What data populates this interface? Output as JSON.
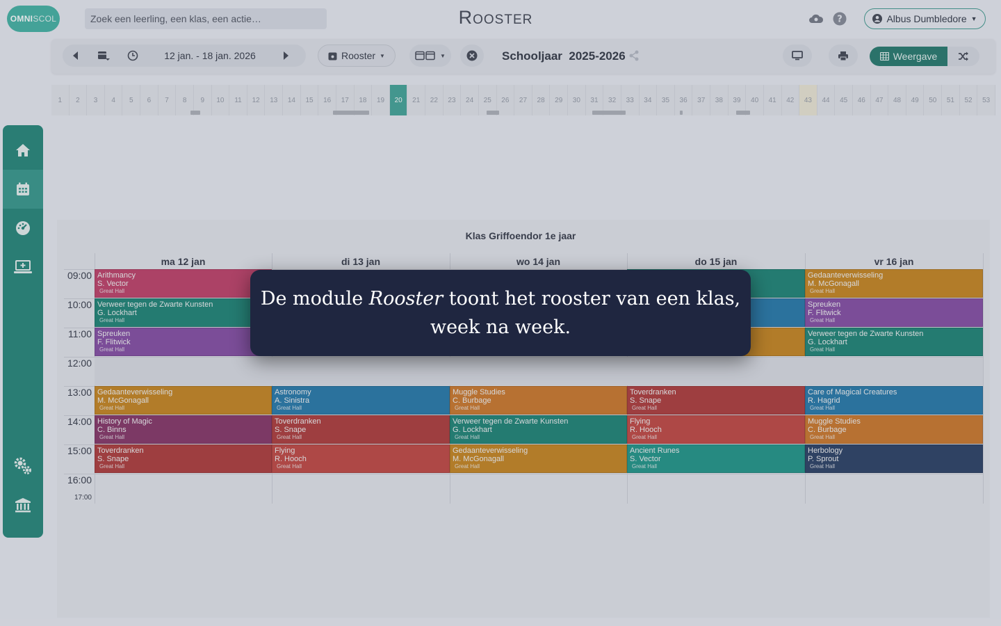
{
  "header": {
    "logo_text_bold": "OMNI",
    "logo_text_light": "SCOL",
    "search_placeholder": "Zoek een leerling, een klas, een actie…",
    "page_title": "Rooster",
    "user_name": "Albus Dumbledore"
  },
  "toolbar": {
    "date_range": "12 jan. - 18 jan. 2026",
    "rooster_dropdown": "Rooster",
    "year_prefix": "Schooljaar",
    "year_value": "2025-2026",
    "weergave_label": "Weergave"
  },
  "weekstrip": {
    "weeks": [
      "1",
      "2",
      "3",
      "4",
      "5",
      "6",
      "7",
      "8",
      "9",
      "10",
      "11",
      "12",
      "13",
      "14",
      "15",
      "16",
      "17",
      "18",
      "19",
      "20",
      "21",
      "22",
      "23",
      "24",
      "25",
      "26",
      "27",
      "28",
      "29",
      "30",
      "31",
      "32",
      "33",
      "34",
      "35",
      "36",
      "37",
      "38",
      "39",
      "40",
      "41",
      "42",
      "43",
      "44",
      "45",
      "46",
      "47",
      "48",
      "49",
      "50",
      "51",
      "52",
      "53"
    ],
    "active_week": "20",
    "highlighted_week": "43"
  },
  "calendar": {
    "title": "Klas Griffoendor 1e jaar",
    "days": [
      "ma 12 jan",
      "di 13 jan",
      "wo 14 jan",
      "do 15 jan",
      "vr 16 jan"
    ],
    "times": [
      "09:00",
      "10:00",
      "11:00",
      "12:00",
      "13:00",
      "14:00",
      "15:00",
      "16:00"
    ],
    "end_time": "17:00",
    "lessons": [
      {
        "day": 0,
        "slot": 0,
        "subject": "Arithmancy",
        "teacher": "S. Vector",
        "room": "Great Hall",
        "color": "#c2486f"
      },
      {
        "day": 0,
        "slot": 1,
        "subject": "Verweer tegen de Zwarte Kunsten",
        "teacher": "G. Lockhart",
        "room": "Great Hall",
        "color": "#27897c"
      },
      {
        "day": 0,
        "slot": 2,
        "subject": "Spreuken",
        "teacher": "F. Flitwick",
        "room": "Great Hall",
        "color": "#8a55a8"
      },
      {
        "day": 0,
        "slot": 4,
        "subject": "Gedaanteverwisseling",
        "teacher": "M. McGonagall",
        "room": "Great Hall",
        "color": "#c98a2a"
      },
      {
        "day": 0,
        "slot": 5,
        "subject": "History of Magic",
        "teacher": "C. Binns",
        "room": "Great Hall",
        "color": "#8b3e6e"
      },
      {
        "day": 0,
        "slot": 6,
        "subject": "Toverdranken",
        "teacher": "S. Snape",
        "room": "Great Hall",
        "color": "#b24444"
      },
      {
        "day": 1,
        "slot": 4,
        "subject": "Astronomy",
        "teacher": "A. Sinistra",
        "room": "Great Hall",
        "color": "#2f7fae"
      },
      {
        "day": 1,
        "slot": 5,
        "subject": "Toverdranken",
        "teacher": "S. Snape",
        "room": "Great Hall",
        "color": "#b24444"
      },
      {
        "day": 1,
        "slot": 6,
        "subject": "Flying",
        "teacher": "R. Hooch",
        "room": "Great Hall",
        "color": "#c44f4a"
      },
      {
        "day": 2,
        "slot": 4,
        "subject": "Muggle Studies",
        "teacher": "C. Burbage",
        "room": "Great Hall",
        "color": "#cf7e34"
      },
      {
        "day": 2,
        "slot": 5,
        "subject": "Verweer tegen de Zwarte Kunsten",
        "teacher": "G. Lockhart",
        "room": "Great Hall",
        "color": "#27897c"
      },
      {
        "day": 2,
        "slot": 6,
        "subject": "Gedaanteverwisseling",
        "teacher": "M. McGonagall",
        "room": "Great Hall",
        "color": "#c98a2a"
      },
      {
        "day": 3,
        "slot": 0,
        "subject": "",
        "teacher": "",
        "room": "",
        "color": "#27897c"
      },
      {
        "day": 3,
        "slot": 1,
        "subject": "",
        "teacher": "",
        "room": "",
        "color": "#2f7fae"
      },
      {
        "day": 3,
        "slot": 2,
        "subject": "",
        "teacher": "",
        "room": "",
        "color": "#c98a2a"
      },
      {
        "day": 3,
        "slot": 4,
        "subject": "Toverdranken",
        "teacher": "S. Snape",
        "room": "Great Hall",
        "color": "#b24444"
      },
      {
        "day": 3,
        "slot": 5,
        "subject": "Flying",
        "teacher": "R. Hooch",
        "room": "Great Hall",
        "color": "#c44f4a"
      },
      {
        "day": 3,
        "slot": 6,
        "subject": "Ancient Runes",
        "teacher": "S. Vector",
        "room": "Great Hall",
        "color": "#2a9a8e"
      },
      {
        "day": 4,
        "slot": 0,
        "subject": "Gedaanteverwisseling",
        "teacher": "M. McGonagall",
        "room": "Great Hall",
        "color": "#c98a2a"
      },
      {
        "day": 4,
        "slot": 1,
        "subject": "Spreuken",
        "teacher": "F. Flitwick",
        "room": "Great Hall",
        "color": "#8a55a8"
      },
      {
        "day": 4,
        "slot": 2,
        "subject": "Verweer tegen de Zwarte Kunsten",
        "teacher": "G. Lockhart",
        "room": "Great Hall",
        "color": "#27897c"
      },
      {
        "day": 4,
        "slot": 4,
        "subject": "Care of Magical Creatures",
        "teacher": "R. Hagrid",
        "room": "Great Hall",
        "color": "#2f7fae"
      },
      {
        "day": 4,
        "slot": 5,
        "subject": "Muggle Studies",
        "teacher": "C. Burbage",
        "room": "Great Hall",
        "color": "#cf7e34"
      },
      {
        "day": 4,
        "slot": 6,
        "subject": "Herbology",
        "teacher": "P. Sprout",
        "room": "Great Hall",
        "color": "#34486b"
      }
    ]
  },
  "tooltip": {
    "part1": "De module ",
    "emphasis": "Rooster",
    "part2": " toont het rooster van een klas, week na week."
  },
  "colors": {
    "accent": "#2e8b7f",
    "tooltip_bg": "#1f2640"
  },
  "sidebar": {
    "icons": [
      "home-icon",
      "calendar-icon",
      "dashboard-icon",
      "screen-plus-icon",
      "gears-icon",
      "institution-icon"
    ]
  }
}
